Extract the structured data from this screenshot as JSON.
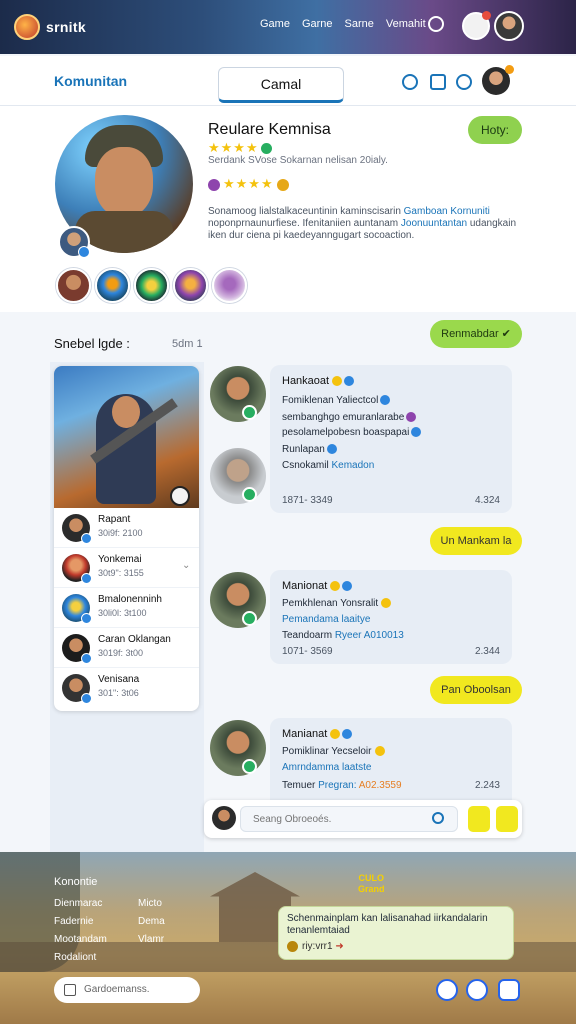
{
  "topbar": {
    "brand": "srnitk",
    "nav": [
      "Game",
      "Garne",
      "Sarne",
      "Vemahit"
    ]
  },
  "subheader": {
    "title": "Komunitan",
    "active_tab": "Camal"
  },
  "profile": {
    "name": "Reulare Kemnisa",
    "stars_row1": "★★★★",
    "subtitle": "Serdank SVose Sokarnan nelisan 20ialy.",
    "stars_row2": "★★★★",
    "description_part1": "Sonamoog lialstalkaceuntinin kaminscisarin ",
    "description_link1": "Gamboan Kornuniti",
    "description_part2": " noponprnaunurfiese. Ifenitaniien auntanam ",
    "description_link2": "Joonuuntantan",
    "description_part3": " udangkain iken dur ciena pi kaedeyanngugart socoaction.",
    "hot_button": "Hoty:"
  },
  "section": {
    "title": "Snebel lgde :",
    "count": "5dm 1",
    "green_pill": "Renmabdar ✔",
    "yellow_pill_1": "Un Mankam la",
    "yellow_pill_2": "Pan Oboolsan"
  },
  "player_list": [
    {
      "name": "Rapant",
      "time": "30i9f: 2100"
    },
    {
      "name": "Yonkemai",
      "time": "30t9\": 3155"
    },
    {
      "name": "Bmalonenninh",
      "time": "30li0l: 3t100"
    },
    {
      "name": "Caran Oklangan",
      "time": "3019f: 3t00"
    },
    {
      "name": "Venisana",
      "time": "301\": 3t06"
    }
  ],
  "messages": [
    {
      "title": "Hankaoat",
      "line1": "Fomiklenan Yaliectcol",
      "line2": "sembanghgo emuranlarabe",
      "line3": "pesolamelpobesn boaspapai",
      "line4": "Runlapan",
      "line5_plain": "Csnokamil ",
      "line5_link": "Kemadon",
      "timestamp": "1871- 3349",
      "score": "4.324"
    },
    {
      "title": "Manionat",
      "line1": "Pemkhlenan Yonsralit",
      "line2": "Pemandama laaitye",
      "line3_plain": "Teandoarm ",
      "line3_link": "Ryeer A010013",
      "timestamp": "1071- 3569",
      "score": "2.344"
    },
    {
      "title": "Manianat",
      "line1": "Pomiklinar Yecseloir",
      "line2": "Amrndamma laatste",
      "line3_plain": "Temuer ",
      "line3_link": "Pregran: ",
      "line3_orange": "A02.3559",
      "timestamp": "",
      "score": "2.243"
    }
  ],
  "input_bar": {
    "placeholder": "Seang Obroeoés."
  },
  "bottom": {
    "heading": "Konontie",
    "col1": [
      "Dienmarac",
      "Fadernie",
      "Mootandam",
      "Rodaliont"
    ],
    "col2": [
      "Micto",
      "Dema",
      "Vlamr"
    ],
    "gold_label_1": "CULO",
    "gold_label_2": "Grand",
    "callout_text": "Schenmainplam kan lalisanahad iirkandalarin tenanlemtaiad",
    "callout_user": "riy:vrr1",
    "callout_arrow": "➜",
    "search_placeholder": "Gardoemanss."
  },
  "colors": {
    "accent": "#1a74b8",
    "green_pill": "#9ad94c",
    "yellow_pill": "#f1e81f",
    "bubble": "#e7edf5"
  }
}
